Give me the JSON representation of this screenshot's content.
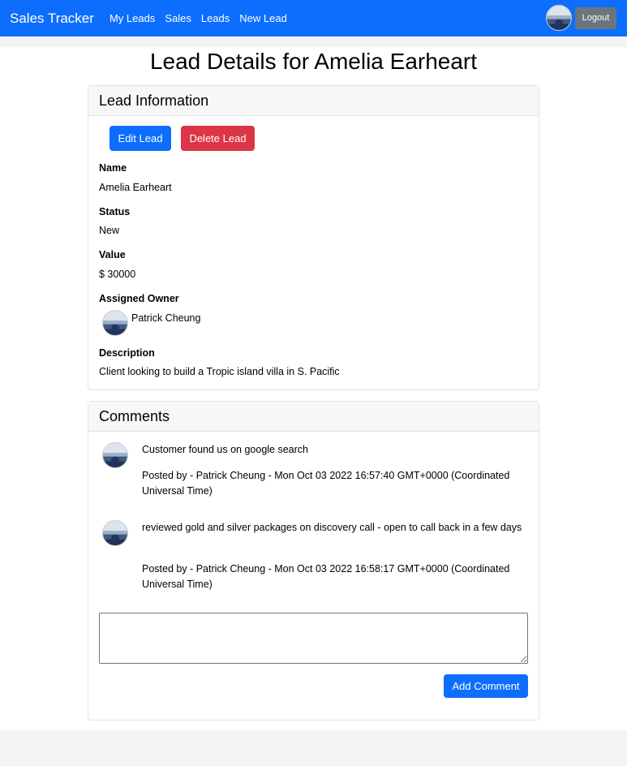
{
  "nav": {
    "brand": "Sales Tracker",
    "links": [
      "My Leads",
      "Sales",
      "Leads",
      "New Lead"
    ],
    "logout_label": "Logout"
  },
  "page": {
    "title": "Lead Details for Amelia Earheart"
  },
  "lead_info": {
    "header": "Lead Information",
    "edit_label": "Edit Lead",
    "delete_label": "Delete Lead",
    "name_label": "Name",
    "name": "Amelia Earheart",
    "status_label": "Status",
    "status": "New",
    "value_label": "Value",
    "value": "$ 30000",
    "owner_label": "Assigned Owner",
    "owner": "Patrick Cheung",
    "description_label": "Description",
    "description": "Client looking to build a Tropic island villa in S. Pacific"
  },
  "comments": {
    "header": "Comments",
    "items": [
      {
        "text": "Customer found us on google search",
        "posted": "Posted by - Patrick Cheung - Mon Oct 03 2022 16:57:40 GMT+0000 (Coordinated Universal Time)"
      },
      {
        "text": "reviewed gold and silver packages on discovery call - open to call back in a few days",
        "posted": "Posted by - Patrick Cheung - Mon Oct 03 2022 16:58:17 GMT+0000 (Coordinated Universal Time)"
      }
    ],
    "input_value": "",
    "add_label": "Add Comment"
  },
  "colors": {
    "primary": "#0d6efd",
    "danger": "#dc3545",
    "secondary": "#6c757d"
  }
}
